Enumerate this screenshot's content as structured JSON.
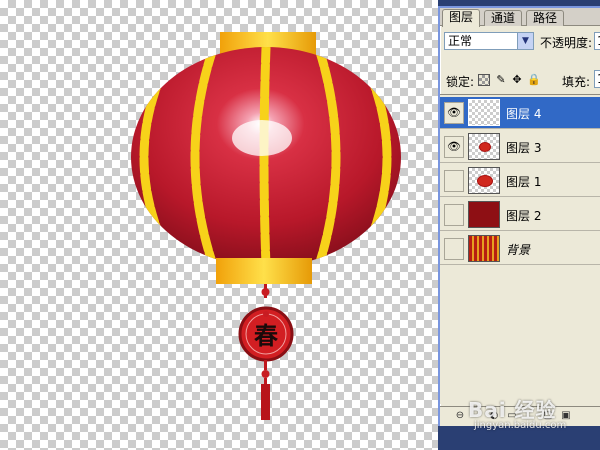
{
  "layers_panel": {
    "tabs": [
      {
        "label": "图层",
        "active": true
      },
      {
        "label": "通道",
        "active": false
      },
      {
        "label": "路径",
        "active": false
      }
    ],
    "blend_mode": "正常",
    "opacity_label": "不透明度:",
    "opacity_value": "1",
    "lock_label": "锁定:",
    "fill_label": "填充:",
    "fill_value": "1",
    "layers": [
      {
        "name": "图层 4",
        "visible": true,
        "selected": true,
        "thumb": "transparent"
      },
      {
        "name": "图层 3",
        "visible": true,
        "selected": false,
        "thumb": "lantern-small"
      },
      {
        "name": "图层 1",
        "visible": false,
        "selected": false,
        "thumb": "lantern"
      },
      {
        "name": "图层 2",
        "visible": false,
        "selected": false,
        "thumb": "dark-red"
      },
      {
        "name": "背景",
        "visible": false,
        "selected": false,
        "thumb": "stripes"
      }
    ]
  },
  "icons": {
    "eye": "eye-icon",
    "lock_transparent": "checker-lock-icon",
    "lock_brush": "brush-icon",
    "lock_move": "move-icon",
    "lock_all": "padlock-icon",
    "blend_dropdown": "chevron-down-icon"
  },
  "lantern": {
    "character": "春"
  },
  "watermark": {
    "brand": "Bai 经验",
    "sub": "jingyan.baidu.com"
  },
  "colors": {
    "selected_row": "#3169c6",
    "panel_bg": "#ece9d8",
    "lantern_red": "#c41e2a",
    "lantern_gold": "#f7d21a"
  }
}
